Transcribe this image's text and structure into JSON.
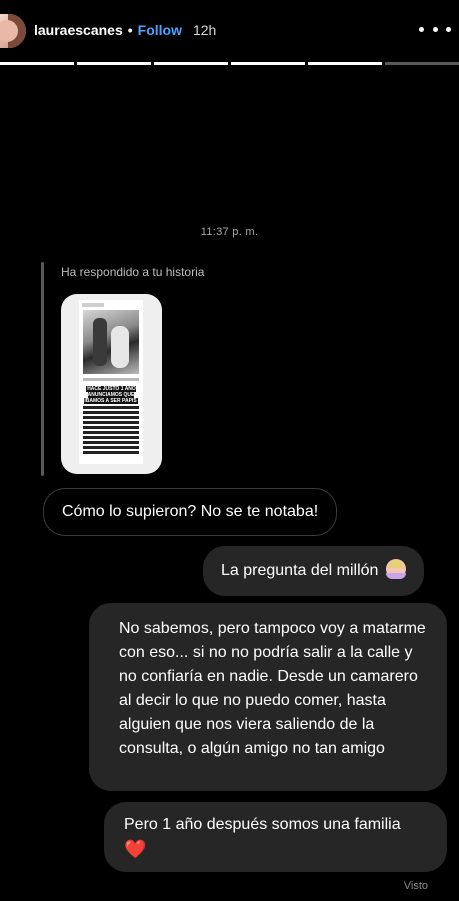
{
  "header": {
    "username": "lauraescanes",
    "separator": "•",
    "follow_label": "Follow",
    "time": "12h",
    "progress": {
      "segments": 6,
      "completed": 5
    }
  },
  "chat": {
    "timestamp": "11:37 p. m.",
    "reply_label": "Ha respondido a tu historia",
    "story_headline": "HACE JUSTO 1 AÑO ANUNCIAMOS QUE ÍBAMOS A SER PAPIS",
    "messages": [
      {
        "side": "in",
        "text": "Cómo lo supieron? No se te notaba!"
      },
      {
        "side": "out",
        "text": "La pregunta del millón",
        "emoji": "person-shrugging-emoji"
      },
      {
        "side": "out",
        "text": "No sabemos, pero tampoco voy a matarme con eso... si no no podría salir a la calle y no confiaría en nadie. Desde un camarero al decir lo que no puedo comer, hasta alguien que nos viera saliendo de la consulta, o algún amigo no tan amigo"
      },
      {
        "side": "out",
        "text": "Pero 1 año después somos una familia",
        "emoji_char": "❤️"
      }
    ],
    "seen_label": "Visto"
  },
  "colors": {
    "follow": "#4aa3ff",
    "bubble_out": "#262626",
    "heart": "#e0102e"
  }
}
